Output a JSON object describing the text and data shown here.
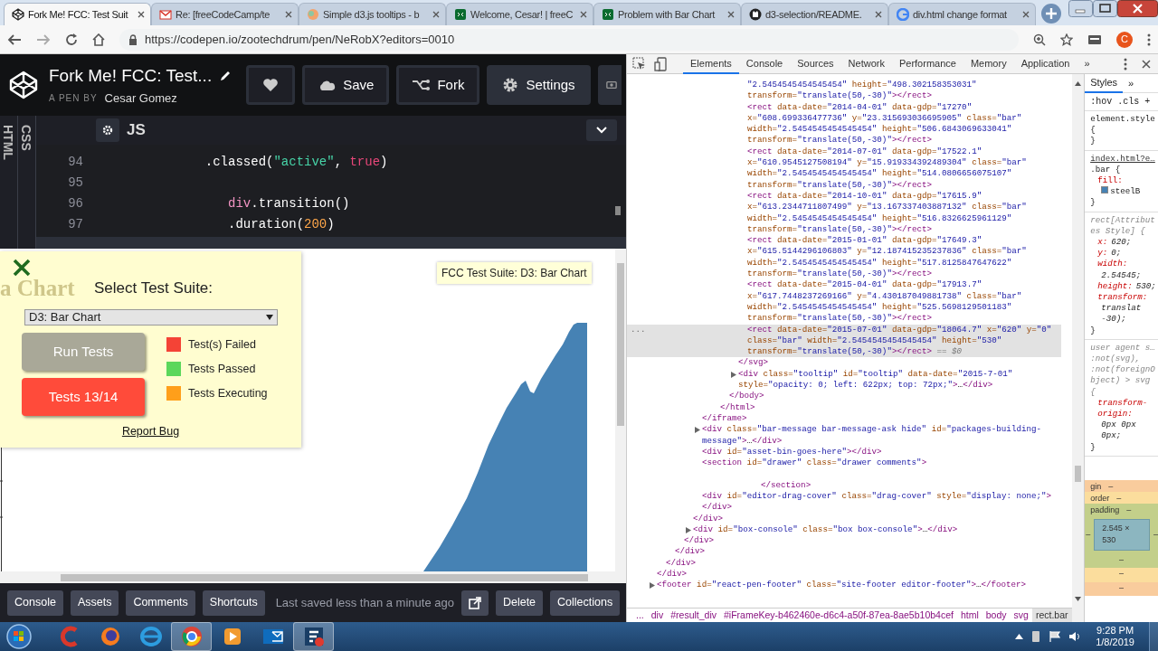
{
  "browser": {
    "tabs": [
      {
        "title": "Fork Me! FCC: Test Suit",
        "selected": true
      },
      {
        "title": "Re: [freeCodeCamp/te",
        "selected": false
      },
      {
        "title": "Simple d3.js tooltips - b",
        "selected": false
      },
      {
        "title": "Welcome, Cesar! | freeC",
        "selected": false
      },
      {
        "title": "Problem with Bar Chart",
        "selected": false
      },
      {
        "title": "d3-selection/README.",
        "selected": false
      },
      {
        "title": "div.html change format",
        "selected": false
      }
    ],
    "url": "https://codepen.io/zootechdrum/pen/NeRobX?editors=0010",
    "profile_initial": "C"
  },
  "codepen": {
    "title": "Fork Me! FCC: Test...",
    "byline": "A PEN BY",
    "author": "Cesar Gomez",
    "actions": [
      "Save",
      "Fork",
      "Settings"
    ],
    "side_tabs": [
      "HTML",
      "CSS"
    ],
    "editor": "JS",
    "code": [
      {
        "number": "94",
        "tokens": [
          {
            "kind": "plain",
            "text": "            .classed("
          },
          {
            "kind": "string",
            "text": "\"active\""
          },
          {
            "kind": "plain",
            "text": ", "
          },
          {
            "kind": "keyword",
            "text": "true"
          },
          {
            "kind": "plain",
            "text": ")"
          }
        ]
      },
      {
        "number": "95"
      },
      {
        "number": "96",
        "tokens": [
          {
            "kind": "variable",
            "text": "               div"
          },
          {
            "kind": "plain",
            "text": ".transition()"
          }
        ]
      },
      {
        "number": "97",
        "tokens": [
          {
            "kind": "plain",
            "text": "               .duration("
          },
          {
            "kind": "number",
            "text": "200"
          },
          {
            "kind": "plain",
            "text": ")"
          }
        ]
      }
    ],
    "result": {
      "faded_heading": "a Chart",
      "tooltip": "FCC Test Suite: D3: Bar Chart",
      "panel": {
        "heading": "Select Test Suite:",
        "suite": "D3: Bar Chart",
        "run": "Run Tests",
        "tests": {
          "label": "Tests 13/14",
          "failed": true
        },
        "legend": [
          {
            "label": "Test(s) Failed",
            "color": "#f44336"
          },
          {
            "label": "Tests Passed",
            "color": "#5bd75b"
          },
          {
            "label": "Tests Executing",
            "color": "#ff9f1a"
          }
        ],
        "report": "Report Bug"
      }
    },
    "footer": {
      "left": [
        "Console",
        "Assets",
        "Comments",
        "Shortcuts"
      ],
      "saved": "Last saved less than a minute ago",
      "right": [
        "Delete",
        "Collections"
      ]
    }
  },
  "devtools": {
    "tabs": [
      {
        "label": "Elements",
        "selected": true
      },
      {
        "label": "Console",
        "selected": false
      },
      {
        "label": "Sources",
        "selected": false
      },
      {
        "label": "Network",
        "selected": false
      },
      {
        "label": "Performance",
        "selected": false
      },
      {
        "label": "Memory",
        "selected": false
      },
      {
        "label": "Application",
        "selected": false
      }
    ],
    "overflow": "»",
    "dom": [
      {
        "children": [
          {
            "children": [
              {
                "children": [
                  {
                    "children": [
                      {
                        "children": [
                          {
                            "children": [
                              {
                                "children": [
                                  {
                                    "children": [
                                      {
                                        "children": [
                                          {
                                            "children": [
                                              {
                                                "text": "\"2.5454545454545454\" height=\"498.302158353031\" transform=\"translate(50,-30)\"></rect>",
                                                "selected": false
                                              },
                                              {
                                                "text": "<rect data-date=\"2014-04-01\" data-gdp=\"17270\" x=\"608.699336477736\" y=\"23.315693036695905\" class=\"bar\" width=\"2.5454545454545454\" height=\"506.6843069633041\" transform=\"translate(50,-30)\"></rect>",
                                                "selected": false
                                              },
                                              {
                                                "text": "<rect data-date=\"2014-07-01\" data-gdp=\"17522.1\" x=\"610.9545127508194\" y=\"15.919334392489304\" class=\"bar\" width=\"2.5454545454545454\" height=\"514.0806656075107\" transform=\"translate(50,-30)\"></rect>",
                                                "selected": false
                                              },
                                              {
                                                "text": "<rect data-date=\"2014-10-01\" data-gdp=\"17615.9\" x=\"613.2344711807499\" y=\"13.167337403887132\" class=\"bar\" width=\"2.5454545454545454\" height=\"516.8326625961129\" transform=\"translate(50,-30)\"></rect>",
                                                "selected": false
                                              },
                                              {
                                                "text": "<rect data-date=\"2015-01-01\" data-gdp=\"17649.3\" x=\"615.5144296106803\" y=\"12.187415235237836\" class=\"bar\" width=\"2.5454545454545454\" height=\"517.8125847647622\" transform=\"translate(50,-30)\"></rect>",
                                                "selected": false
                                              },
                                              {
                                                "text": "<rect data-date=\"2015-04-01\" data-gdp=\"17913.7\" x=\"617.7448237269166\" y=\"4.430187049881738\" class=\"bar\" width=\"2.5454545454545454\" height=\"525.5698129501183\" transform=\"translate(50,-30)\"></rect>",
                                                "selected": false
                                              },
                                              {
                                                "text": "<rect data-date=\"2015-07-01\" data-gdp=\"18064.7\" x=\"620\" y=\"0\" class=\"bar\" width=\"2.5454545454545454\" height=\"530\" transform=\"translate(50,-30)\"></rect>",
                                                "selected": true,
                                                "ref": "== $0",
                                                "gutter": "..."
                                              }
                                            ]
                                          },
                                          {
                                            "text": "</svg>",
                                            "selected": false
                                          },
                                          {
                                            "text": "<div class=\"tooltip\" id=\"tooltip\" data-date=\"2015-7-01\" style=\"opacity: 0; left: 622px; top: 72px;\">…</div>",
                                            "selected": false,
                                            "expanded": false
                                          }
                                        ]
                                      },
                                      {
                                        "text": "</body>",
                                        "selected": false
                                      }
                                    ]
                                  },
                                  {
                                    "text": "</html>",
                                    "selected": false
                                  }
                                ]
                              }
                            ]
                          },
                          {
                            "text": "</iframe>",
                            "selected": false
                          },
                          {
                            "text": "<div class=\"bar-message bar-message-ask hide\" id=\"packages-building-message\">…</div>",
                            "selected": false,
                            "expanded": false
                          },
                          {
                            "text": "<div id=\"asset-bin-goes-here\"></div>",
                            "selected": false
                          },
                          {
                            "text": "<section id=\"drawer\" class=\"drawer comments\">",
                            "selected": false,
                            "close": "</section>"
                          },
                          {
                            "text": "<div id=\"editor-drag-cover\" class=\"drag-cover\" style=\"display: none;\">",
                            "selected": false
                          },
                          {
                            "text": "</div>",
                            "selected": false
                          }
                        ]
                      },
                      {
                        "text": "</div>",
                        "selected": false
                      },
                      {
                        "text": "<div id=\"box-console\" class=\"box box-console\">…</div>",
                        "selected": false,
                        "expanded": false
                      }
                    ]
                  },
                  {
                    "text": "</div>",
                    "selected": false
                  }
                ]
              },
              {
                "text": "</div>",
                "selected": false
              }
            ]
          },
          {
            "text": "</div>",
            "selected": false
          }
        ]
      },
      {
        "text": "</div>",
        "selected": false
      },
      {
        "text": "<footer id=\"react-pen-footer\" class=\"site-footer editor-footer\">…</footer>",
        "selected": false,
        "expanded": false
      }
    ],
    "breadcrumbs": [
      {
        "label": "...",
        "selected": false
      },
      {
        "label": "div",
        "selected": false
      },
      {
        "label": "#result_div",
        "selected": false
      },
      {
        "label": "#iFrameKey-b462460e-d6c4-a50f-87ea-8ae5b10b4cef",
        "selected": false
      },
      {
        "label": "html",
        "selected": false
      },
      {
        "label": "body",
        "selected": false
      },
      {
        "label": "svg",
        "selected": false
      },
      {
        "label": "rect.bar",
        "selected": true
      }
    ],
    "styles": {
      "tabs": [
        {
          "label": "Styles",
          "selected": true
        }
      ],
      "overflow": "»",
      "filters": [
        ":hov",
        ".cls",
        "+"
      ],
      "rules": [
        {
          "kind": "inline",
          "selector": "element.style {",
          "close": "}"
        },
        {
          "kind": "author",
          "source": "index.html?e…",
          "selector": ".bar {",
          "declarations": [
            {
              "property": "fill:",
              "value": "steelB",
              "color": "#4682b4"
            }
          ],
          "close": "}"
        },
        {
          "kind": "attributes",
          "selector": "rect[Attributes Style] {",
          "declarations": [
            {
              "property": "x:",
              "value": "620;"
            },
            {
              "property": "y:",
              "value": "0;"
            },
            {
              "property": "width:",
              "value": "2.54545;"
            },
            {
              "property": "height:",
              "value": "530;"
            },
            {
              "property": "transform:",
              "value": "translat",
              "continued": "-30);"
            }
          ],
          "close": "}"
        },
        {
          "kind": "user-agent",
          "source": "user agent s…",
          "selector": ":not(svg), :not(foreignObject) > svg {",
          "declarations": [
            {
              "property": "transform-origin:",
              "value": "0px 0px 0px;"
            }
          ],
          "close": "}"
        }
      ],
      "box_model": {
        "margin": {
          "label": "gin",
          "top": "–",
          "bottom": "–"
        },
        "border": {
          "label": "order",
          "top": "–",
          "bottom": "–"
        },
        "padding": {
          "label": "padding",
          "top": "–",
          "left": "–",
          "right": "–",
          "bottom": "–"
        },
        "content": "2.545 × 530"
      }
    }
  },
  "taskbar": {
    "apps": [
      {
        "running": false
      },
      {
        "running": false
      },
      {
        "running": false
      },
      {
        "running": true
      },
      {
        "running": false
      },
      {
        "running": false
      },
      {
        "running": true
      }
    ],
    "time": "9:28 PM",
    "date": "1/8/2019"
  }
}
